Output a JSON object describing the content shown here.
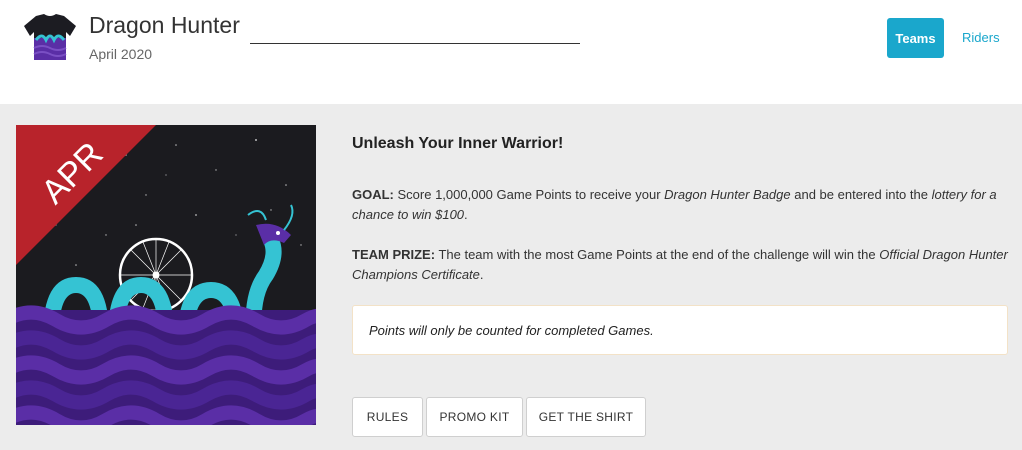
{
  "header": {
    "title": "Dragon Hunter",
    "subtitle": "April 2020",
    "nav": {
      "teams": "Teams",
      "riders": "Riders"
    }
  },
  "artwork": {
    "month_banner": "APR"
  },
  "content": {
    "heading": "Unleash Your Inner Warrior!",
    "goal": {
      "label": "GOAL:",
      "text1": " Score 1,000,000 Game Points to receive your ",
      "badge": "Dragon Hunter Badge",
      "text2": " and be entered into the ",
      "lottery": "lottery for a chance to win $100",
      "end": "."
    },
    "prize": {
      "label": "TEAM PRIZE:",
      "text1": " The team with the most Game Points at the end of the challenge will win the ",
      "certificate": "Official Dragon Hunter Champions Certificate",
      "end": "."
    },
    "notice": "Points will only be counted for completed Games."
  },
  "buttons": {
    "rules": "RULES",
    "promo": "PROMO KIT",
    "shirt": "GET THE SHIRT"
  },
  "colors": {
    "accent": "#1aa7cc",
    "banner": "#b8232b",
    "dragon": "#35c3d3",
    "sea": "#5a2ea6"
  }
}
